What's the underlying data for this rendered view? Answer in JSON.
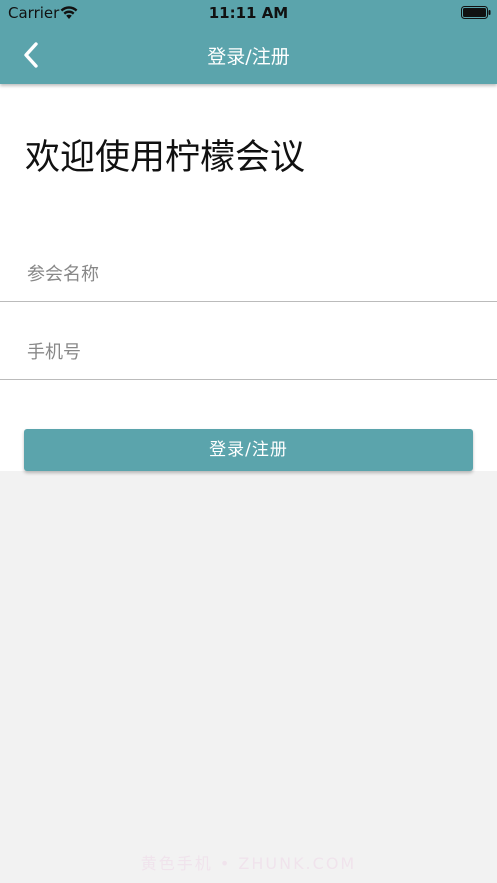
{
  "status_bar": {
    "carrier": "Carrier",
    "time": "11:11 AM"
  },
  "nav": {
    "back_icon": "chevron-left-icon",
    "title": "登录/注册"
  },
  "welcome": {
    "title": "欢迎使用柠檬会议"
  },
  "form": {
    "name_placeholder": "参会名称",
    "phone_placeholder": "手机号",
    "name_value": "",
    "phone_value": ""
  },
  "login_button": {
    "label": "登录/注册"
  },
  "watermark": {
    "text": "黄色手机 • ZHUNK.COM"
  },
  "colors": {
    "accent": "#5ba4ac",
    "background": "#f2f2f2",
    "content": "#ffffff"
  }
}
